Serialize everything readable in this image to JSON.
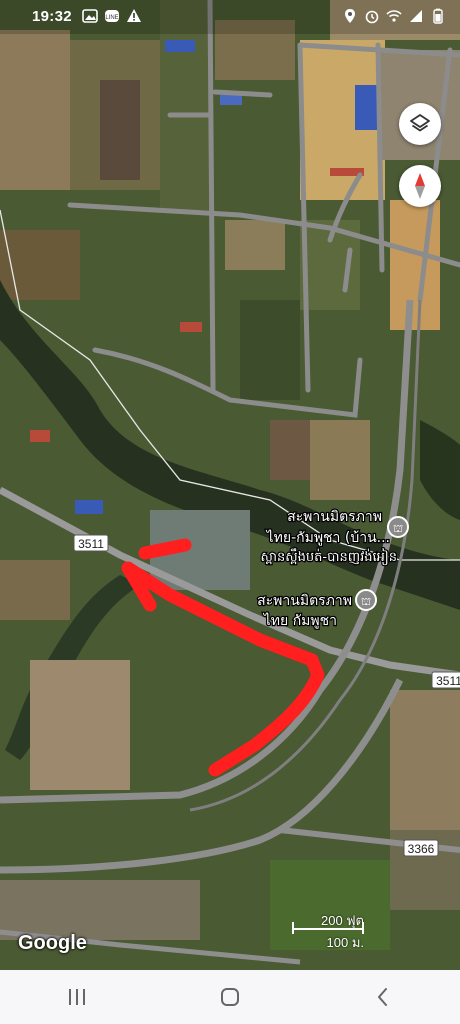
{
  "status_bar": {
    "time": "19:32",
    "left_icons": [
      "gallery-icon",
      "line-app-icon",
      "alert-icon"
    ],
    "right_icons": [
      "location-icon",
      "alarm-icon",
      "wifi-icon",
      "signal-icon",
      "battery-icon"
    ]
  },
  "map": {
    "labels": {
      "bridge1_line1": "สะพานมิตรภาพ",
      "bridge1_line2": "ไทย-กัมพูชา (บ้าน...",
      "bridge1_line3": "ស្ពានស្ពឹងបត់-បានញវង់អៀន",
      "bridge2_line1": "สะพานมิตรภาพ",
      "bridge2_line2": "ไทย กัมพูชา",
      "road_3511_left": "3511",
      "road_3511_right": "3511",
      "road_3366": "3366"
    },
    "icons": [
      "layers-icon",
      "compass-icon",
      "landmark-icon"
    ],
    "colors": {
      "annotation_arrow": "#ff1f1f",
      "road": "#8c8c8c",
      "river": "#2e3b22",
      "vegetation": "#3f5628"
    }
  },
  "google_logo": "Google",
  "scale": {
    "top": "200 ฟุต",
    "bottom": "100 ม."
  },
  "nav": [
    "recents-icon",
    "home-icon",
    "back-icon"
  ]
}
